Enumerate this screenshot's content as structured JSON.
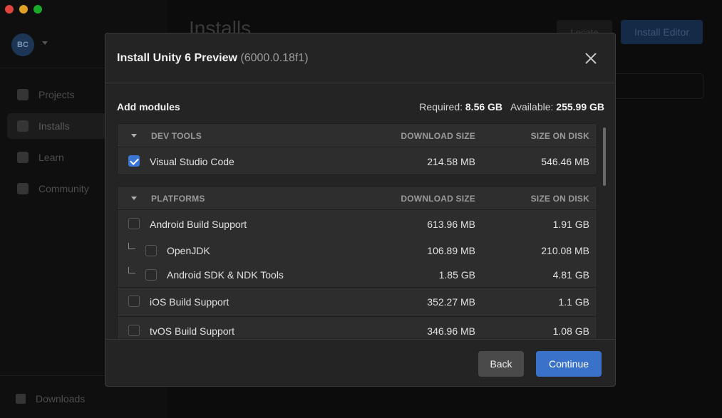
{
  "background_app": {
    "avatar_initials": "BC",
    "nav": [
      {
        "label": "Projects",
        "icon": "cube-icon"
      },
      {
        "label": "Installs",
        "icon": "lock-icon"
      },
      {
        "label": "Learn",
        "icon": "graduation-cap-icon"
      },
      {
        "label": "Community",
        "icon": "people-icon"
      }
    ],
    "downloads_label": "Downloads",
    "page_title": "Installs",
    "locate_label": "Locate",
    "install_editor_label": "Install Editor"
  },
  "modal": {
    "title": "Install Unity 6 Preview",
    "version": "(6000.0.18f1)",
    "add_modules_label": "Add modules",
    "required_label": "Required:",
    "required_value": "8.56 GB",
    "available_label": "Available:",
    "available_value": "255.99 GB",
    "sections": [
      {
        "name": "DEV TOOLS",
        "download_size_header": "DOWNLOAD SIZE",
        "size_on_disk_header": "SIZE ON DISK",
        "rows": [
          {
            "label": "Visual Studio Code",
            "download": "214.58 MB",
            "disk": "546.46 MB",
            "checked": true
          }
        ]
      },
      {
        "name": "PLATFORMS",
        "download_size_header": "DOWNLOAD SIZE",
        "size_on_disk_header": "SIZE ON DISK",
        "rows": [
          {
            "label": "Android Build Support",
            "download": "613.96 MB",
            "disk": "1.91 GB",
            "checked": false
          },
          {
            "label": "OpenJDK",
            "download": "106.89 MB",
            "disk": "210.08 MB",
            "checked": false,
            "sub": true
          },
          {
            "label": "Android SDK & NDK Tools",
            "download": "1.85 GB",
            "disk": "4.81 GB",
            "checked": false,
            "sub": true
          },
          {
            "label": "iOS Build Support",
            "download": "352.27 MB",
            "disk": "1.1 GB",
            "checked": false
          },
          {
            "label": "tvOS Build Support",
            "download": "346.96 MB",
            "disk": "1.08 GB",
            "checked": false
          }
        ]
      }
    ],
    "back_label": "Back",
    "continue_label": "Continue"
  }
}
